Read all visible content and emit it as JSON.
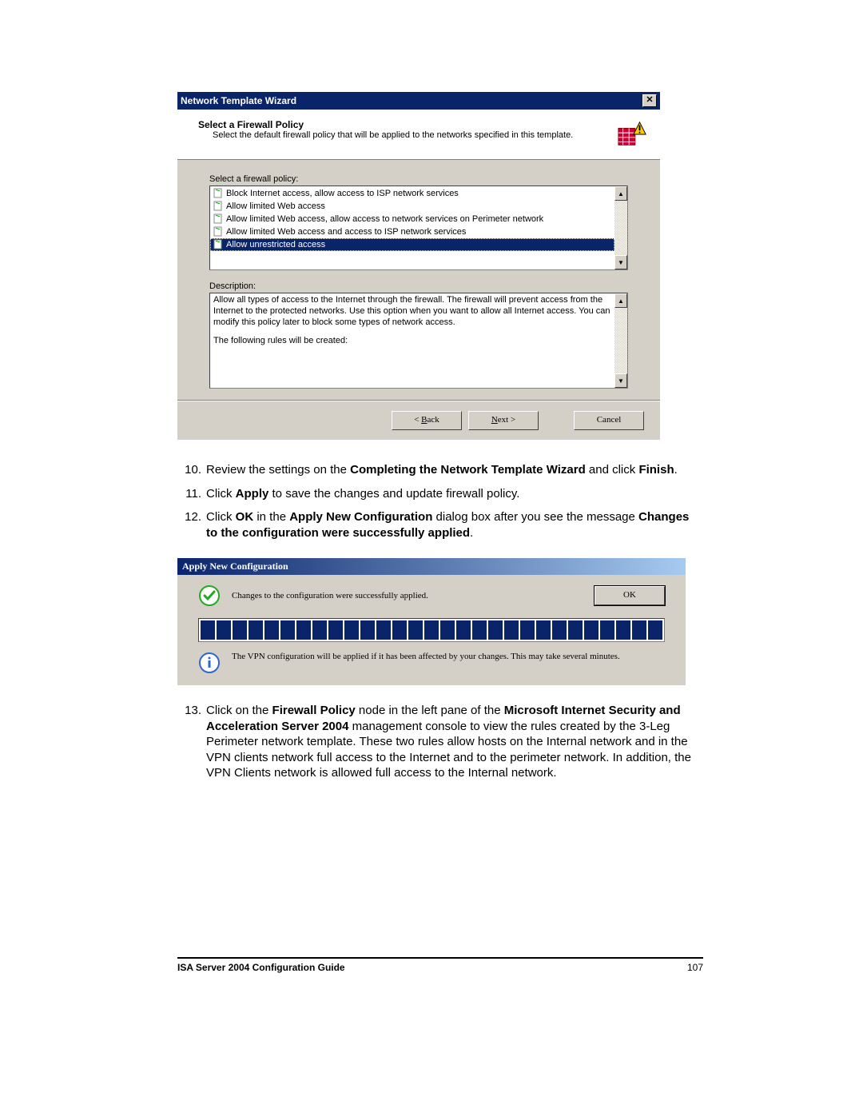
{
  "wizard": {
    "title": "Network Template Wizard",
    "header_title": "Select a Firewall Policy",
    "header_sub": "Select the default firewall policy that will be applied to the networks specified in this template.",
    "list_label": "Select a firewall policy:",
    "items": [
      "Block Internet access, allow access to ISP network services",
      "Allow limited Web access",
      "Allow limited Web access, allow access to network services on Perimeter network",
      "Allow limited Web access and access to ISP network services",
      "Allow unrestricted access"
    ],
    "selected_index": 4,
    "desc_label": "Description:",
    "desc": "Allow all types of access to the Internet through the firewall. The firewall will prevent access from the Internet to the protected networks. Use this option when you want to allow all Internet access. You can modify this policy later to block some types of network access.",
    "rules_intro": "The following rules will be created:",
    "back": "< Back",
    "next": "Next >",
    "cancel": "Cancel"
  },
  "steps": {
    "s10a": "Review the settings on the ",
    "s10b": "Completing the Network Template Wizard",
    "s10c": " and click ",
    "s10d": "Finish",
    "s10e": ".",
    "s11a": "Click ",
    "s11b": "Apply",
    "s11c": " to save the changes and update firewall policy.",
    "s12a": "Click ",
    "s12b": "OK",
    "s12c": " in the ",
    "s12d": "Apply New Configuration",
    "s12e": " dialog box after you see the message ",
    "s12f": "Changes to the configuration were successfully applied",
    "s12g": ".",
    "s13a": "Click on the ",
    "s13b": "Firewall Policy",
    "s13c": " node in the left pane of the ",
    "s13d": "Microsoft Internet Security and Acceleration Server 2004",
    "s13e": " management console to view the rules created by the 3-Leg Perimeter network template. These two rules allow hosts on the Internal network and in the VPN clients network full access to the Internet and to the perimeter network. In addition, the VPN Clients network is allowed full access to the Internal network."
  },
  "apply": {
    "title": "Apply New Configuration",
    "msg": "Changes to the configuration were successfully applied.",
    "ok": "OK",
    "info": "The VPN configuration will be applied if it has been affected by your changes. This may take several minutes."
  },
  "footer": {
    "title": "ISA Server 2004 Configuration Guide",
    "page": "107"
  }
}
